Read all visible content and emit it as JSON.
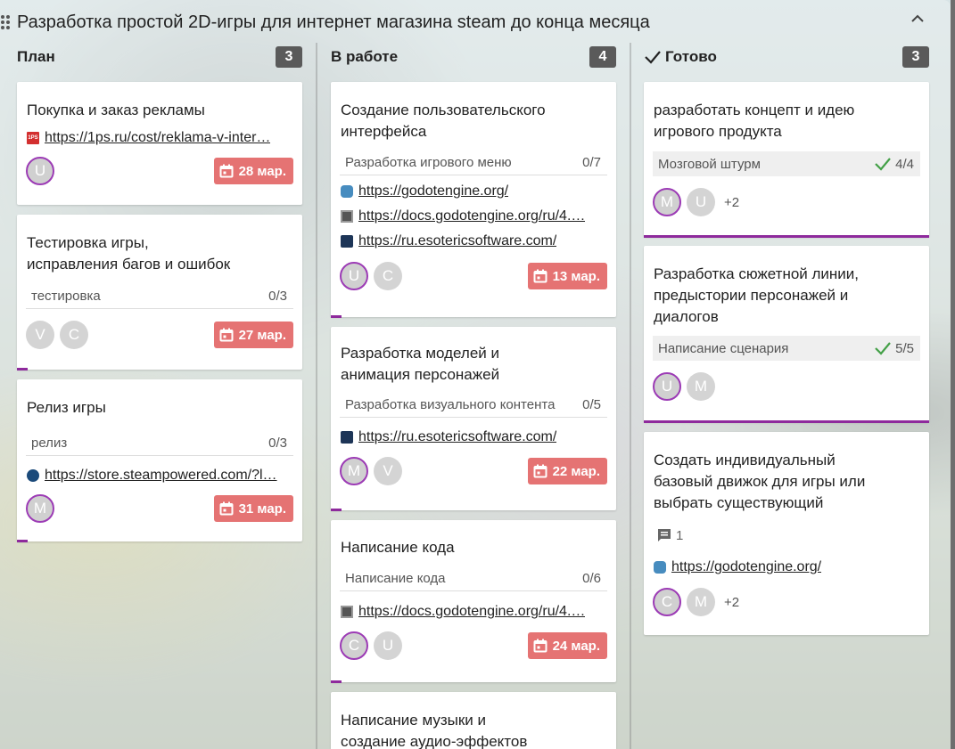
{
  "board": {
    "title": "Разработка простой 2D-игры для интернет магазина steam до конца месяца"
  },
  "columns": [
    {
      "title": "План",
      "count": "3"
    },
    {
      "title": "В работе",
      "count": "4"
    },
    {
      "title": "Готово",
      "count": "3"
    }
  ],
  "plan": {
    "c1": {
      "title": "Покупка и заказ рекламы",
      "link": "https://1ps.ru/cost/reklama-v-inter…",
      "avatars": [
        "U"
      ],
      "due": "28 мар."
    },
    "c2": {
      "title_line1": "Тестировка игры,",
      "title_line2": "исправления багов и ошибок",
      "checklist": "тестировка",
      "checklist_count": "0/3",
      "avatars": [
        "V",
        "C"
      ],
      "due": "27 мар."
    },
    "c3": {
      "title": "Релиз игры",
      "checklist": "релиз",
      "checklist_count": "0/3",
      "link": "https://store.steampowered.com/?l…",
      "avatars": [
        "M"
      ],
      "due": "31 мар."
    }
  },
  "work": {
    "c1": {
      "title_line1": "Создание пользовательского",
      "title_line2": "интерфейса",
      "checklist": "Разработка игрового меню",
      "checklist_count": "0/7",
      "links": [
        "https://godotengine.org/",
        "https://docs.godotengine.org/ru/4.…",
        "https://ru.esotericsoftware.com/"
      ],
      "avatars": [
        "U",
        "C"
      ],
      "due": "13 мар."
    },
    "c2": {
      "title_line1": "Разработка моделей и",
      "title_line2": "анимация персонажей",
      "checklist": "Разработка визуального контента",
      "checklist_count": "0/5",
      "link": "https://ru.esotericsoftware.com/",
      "avatars": [
        "M",
        "V"
      ],
      "due": "22 мар."
    },
    "c3": {
      "title": "Написание кода",
      "checklist": "Написание кода",
      "checklist_count": "0/6",
      "link": "https://docs.godotengine.org/ru/4.…",
      "avatars": [
        "C",
        "U"
      ],
      "due": "24 мар."
    },
    "c4": {
      "title_line1": "Написание музыки и",
      "title_line2": "создание аудио-эффектов"
    }
  },
  "done": {
    "c1": {
      "title_line1": "разработать концепт и идею",
      "title_line2": "игрового продукта",
      "checklist": "Мозговой штурм",
      "checklist_count": "4/4",
      "avatars": [
        "M",
        "U"
      ],
      "extra": "+2"
    },
    "c2": {
      "title_line1": "Разработка сюжетной линии,",
      "title_line2": "предыстории персонажей и",
      "title_line3": "диалогов",
      "checklist": "Написание сценария",
      "checklist_count": "5/5",
      "avatars": [
        "U",
        "M"
      ]
    },
    "c3": {
      "title_line1": "Создать индивидуальный",
      "title_line2": "базовый движок для игры или",
      "title_line3": "выбрать существующий",
      "comments": "1",
      "link": "https://godotengine.org/",
      "avatars": [
        "C",
        "M"
      ],
      "extra": "+2"
    }
  },
  "colors": {
    "due_bg": "#e57373",
    "count_bg": "#5a5a5a",
    "accent_purple": "#8e2a9c",
    "check_green": "#43a047"
  }
}
